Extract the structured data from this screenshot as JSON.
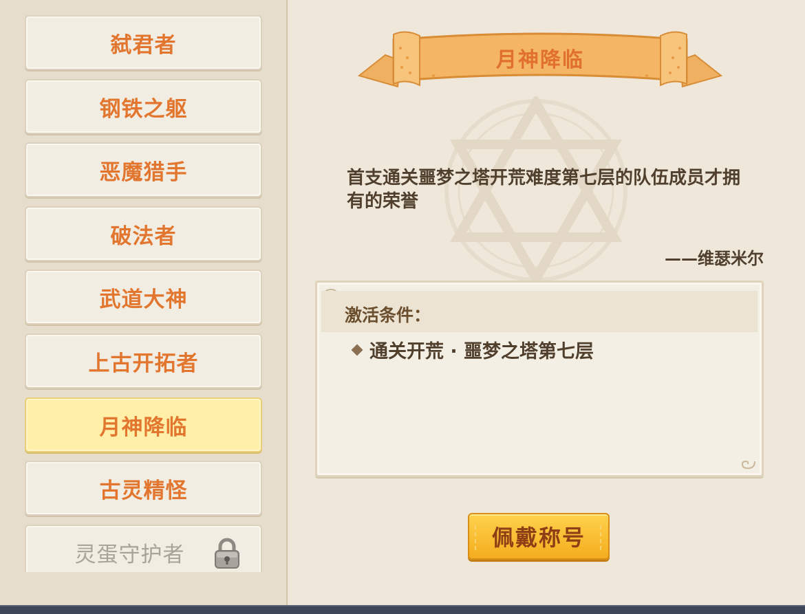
{
  "title_list": {
    "items": [
      {
        "label": "弑君者",
        "state": "normal"
      },
      {
        "label": "钢铁之躯",
        "state": "normal"
      },
      {
        "label": "恶魔猎手",
        "state": "normal"
      },
      {
        "label": "破法者",
        "state": "normal"
      },
      {
        "label": "武道大神",
        "state": "normal"
      },
      {
        "label": "上古开拓者",
        "state": "normal"
      },
      {
        "label": "月神降临",
        "state": "selected"
      },
      {
        "label": "古灵精怪",
        "state": "normal"
      },
      {
        "label": "灵蛋守护者",
        "state": "locked"
      }
    ]
  },
  "detail": {
    "banner_title": "月神降临",
    "description": "首支通关噩梦之塔开荒难度第七层的队伍成员才拥有的荣誉",
    "author": "——维瑟米尔",
    "condition_title": "激活条件：",
    "conditions": [
      "通关开荒 · 噩梦之塔第七层"
    ],
    "wear_button_label": "佩戴称号"
  },
  "colors": {
    "label_orange": "#e2762f",
    "selected_bg": "#ffefa8",
    "button_gold": "#f4ad1e",
    "text_brown": "#4f3f2c",
    "locked_gray": "#a9a39a"
  },
  "icons": {
    "lock": "padlock-icon",
    "bullet": "diamond-bullet-icon",
    "emblem": "hexagram-emblem-icon",
    "banner": "ribbon-banner"
  }
}
